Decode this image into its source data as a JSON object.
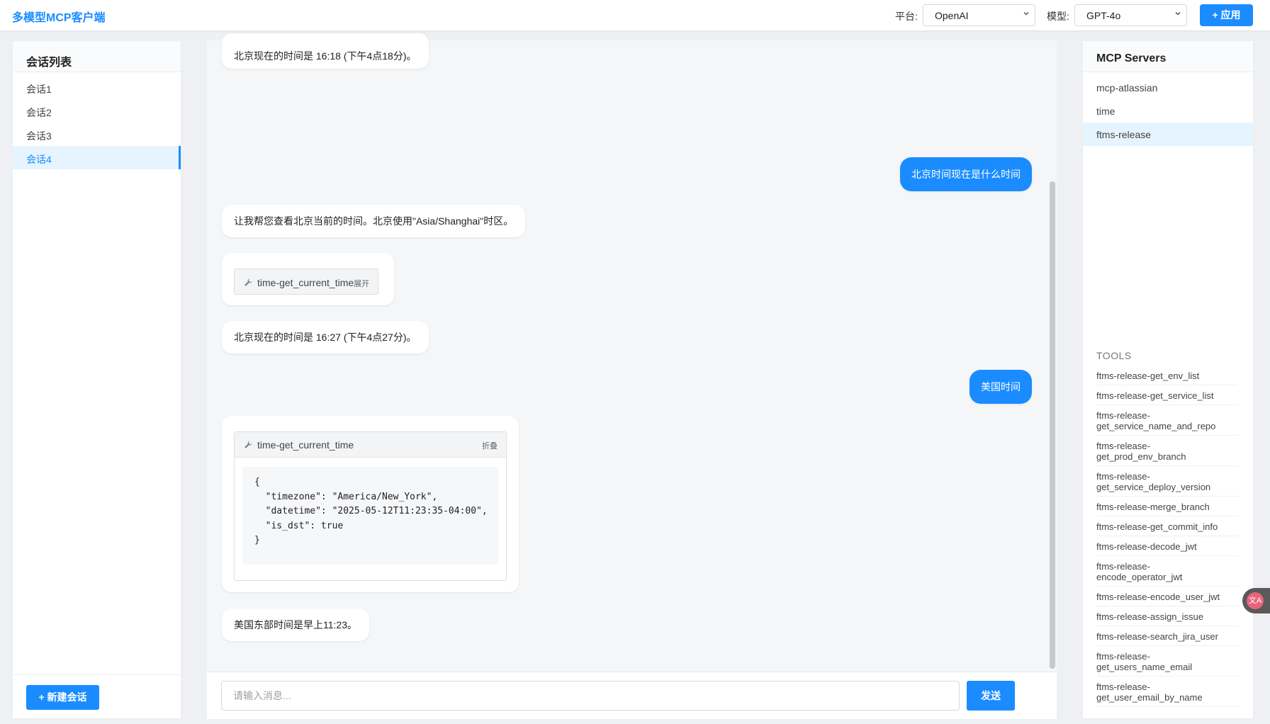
{
  "header": {
    "app_title": "多模型MCP客户端",
    "platform_label": "平台:",
    "platform_value": "OpenAI",
    "model_label": "模型:",
    "model_value": "GPT-4o",
    "apply_label": "+ 应用"
  },
  "sidebar": {
    "title": "会话列表",
    "conversations": [
      {
        "label": "会话1"
      },
      {
        "label": "会话2"
      },
      {
        "label": "会话3"
      },
      {
        "label": "会话4"
      }
    ],
    "new_conversation_label": "+ 新建会话"
  },
  "chat": {
    "messages": [
      {
        "role": "assistant",
        "text": "北京现在的时间是 16:18 (下午4点18分)。"
      },
      {
        "role": "user",
        "text": "北京时间现在是什么时间"
      },
      {
        "role": "assistant",
        "text": "让我帮您查看北京当前的时间。北京使用\"Asia/Shanghai\"时区。"
      },
      {
        "role": "tool",
        "name": "time-get_current_time",
        "toggle": "展开"
      },
      {
        "role": "assistant",
        "text": "北京现在的时间是 16:27 (下午4点27分)。"
      },
      {
        "role": "user",
        "text": "美国时间"
      },
      {
        "role": "tool_expanded",
        "name": "time-get_current_time",
        "toggle": "折叠",
        "output": "{\n  \"timezone\": \"America/New_York\",\n  \"datetime\": \"2025-05-12T11:23:35-04:00\",\n  \"is_dst\": true\n}"
      },
      {
        "role": "assistant",
        "text": "美国东部时间是早上11:23。"
      }
    ],
    "input_placeholder": "请输入消息...",
    "send_label": "发送"
  },
  "servers": {
    "title": "MCP Servers",
    "items": [
      {
        "label": "mcp-atlassian"
      },
      {
        "label": "time"
      },
      {
        "label": "ftms-release"
      }
    ],
    "tools_title": "TOOLS",
    "tools": [
      "ftms-release-get_env_list",
      "ftms-release-get_service_list",
      "ftms-release-get_service_name_and_repo",
      "ftms-release-get_prod_env_branch",
      "ftms-release-get_service_deploy_version",
      "ftms-release-merge_branch",
      "ftms-release-get_commit_info",
      "ftms-release-decode_jwt",
      "ftms-release-encode_operator_jwt",
      "ftms-release-encode_user_jwt",
      "ftms-release-assign_issue",
      "ftms-release-search_jira_user",
      "ftms-release-get_users_name_email",
      "ftms-release-get_user_email_by_name"
    ]
  },
  "colors": {
    "accent": "#1a8cff",
    "active_bg": "#e6f4ff"
  }
}
